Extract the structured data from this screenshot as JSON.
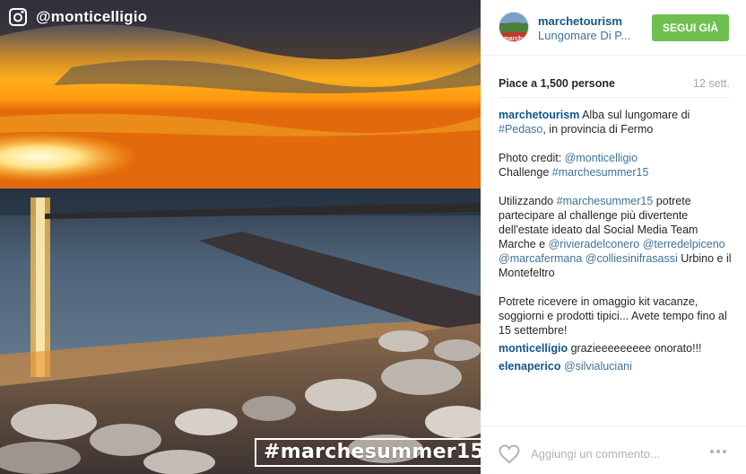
{
  "photo": {
    "overlay_handle": "@monticelligio",
    "stamp_hashtag": "#marchesummer15"
  },
  "header": {
    "username": "marchetourism",
    "location": "Lungomare Di P...",
    "follow_label": "SEGUI GIÀ",
    "avatar_text": "marche"
  },
  "stats": {
    "likes": "Piace a 1,500 persone",
    "date": "12 sett."
  },
  "caption": {
    "author": "marchetourism",
    "line1_text": " Alba sul lungomare di ",
    "tag_pedaso": "#Pedaso",
    "line1_tail": ", in provincia di Fermo",
    "credit_label": "Photo credit: ",
    "credit_handle": "@monticelligio",
    "challenge_label": "Challenge ",
    "challenge_tag": "#marchesummer15",
    "p3_a": "Utilizzando ",
    "p3_tag": "#marchesummer15",
    "p3_b": " potrete partecipare al challenge più divertente dell'estate ideato dal Social Media Team Marche e ",
    "p3_m1": "@rivieradelconero",
    "p3_m2": "@terredelpiceno",
    "p3_m3": "@marcafermana",
    "p3_m4": "@colliesinifrasassi",
    "p3_c": " Urbino e il Montefeltro",
    "p4": "Potrete ricevere in omaggio kit vacanze, soggiorni e prodotti tipici... Avete tempo fino al 15 settembre!"
  },
  "comments": [
    {
      "user": "monticelligio",
      "text": " grazieeeeeeeee onorato!!!"
    },
    {
      "user": "elenaperico",
      "mention": "@silvialuciani"
    }
  ],
  "footer": {
    "comment_placeholder": "Aggiungi un commento..."
  }
}
